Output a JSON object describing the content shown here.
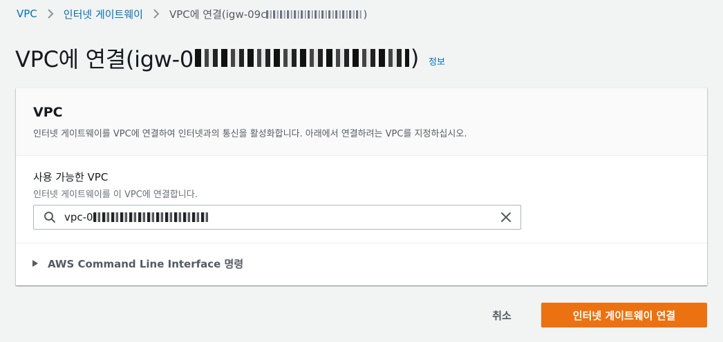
{
  "breadcrumb": {
    "items": [
      {
        "label": "VPC"
      },
      {
        "label": "인터넷 게이트웨이"
      }
    ],
    "current_prefix": "VPC에 연결(igw-09c",
    "current_suffix": ")"
  },
  "page": {
    "title_prefix": "VPC에 연결(igw-0",
    "title_suffix": ")",
    "info_link": "정보"
  },
  "panel": {
    "title": "VPC",
    "description": "인터넷 게이트웨이를 VPC에 연결하여 인터넷과의 통신을 활성화합니다. 아래에서 연결하려는 VPC를 지정하십시오.",
    "field_label": "사용 가능한 VPC",
    "field_description": "인터넷 게이트웨이를 이 VPC에 연결합니다.",
    "search_value_prefix": "vpc-0",
    "expander_label": "AWS Command Line Interface 명령"
  },
  "footer": {
    "cancel_label": "취소",
    "primary_label": "인터넷 게이트웨이 연결"
  },
  "colors": {
    "link": "#0073bb",
    "primary": "#ec7211",
    "background": "#f2f3f3"
  },
  "icons": {
    "breadcrumb_separator": "chevron-right-icon",
    "search": "search-icon",
    "clear": "close-icon",
    "expander": "caret-right-icon"
  }
}
